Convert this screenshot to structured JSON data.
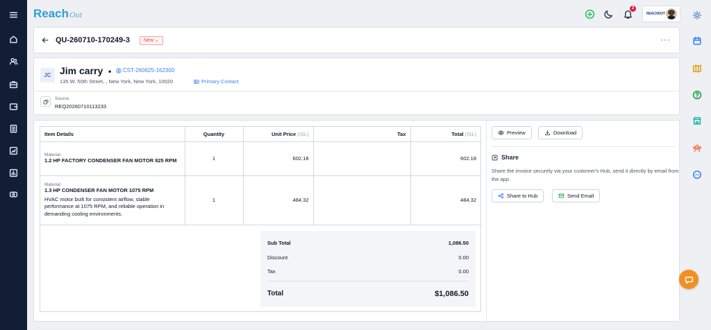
{
  "brand": {
    "name": "Reach",
    "suffix": "Out",
    "company_logo_text": "REACHOUT"
  },
  "notifications": {
    "count": "2"
  },
  "quote": {
    "number": "QU-260710-170249-3",
    "status": "New",
    "status_caret": "⌄",
    "more": "···"
  },
  "customer": {
    "initials": "JC",
    "name": "Jim carry",
    "separator": "•",
    "id": "CST-260625-162300",
    "address": "135 W. 50th Street, , New York, New York, 10020",
    "contact_label": "Primary Contact",
    "source_label": "Source",
    "source_value": "REQ20260710113233"
  },
  "table": {
    "headers": {
      "item": "Item Details",
      "qty": "Quantity",
      "price": "Unit Price",
      "price_note": "(ISL)",
      "tax": "Tax",
      "total": "Total",
      "total_note": "(ISL)"
    },
    "rows": [
      {
        "type": "Material",
        "name": "1.2 HP FACTORY CONDENSER FAN MOTOR 825 RPM",
        "description": "",
        "quantity": "1",
        "unit_price": "602.18",
        "tax": "",
        "total": "602.18"
      },
      {
        "type": "Material",
        "name": "1.3 HP CONDENSER FAN MOTOR 1075 RPM",
        "description": "HVAC motor built for consistent airflow, stable performance at 1075 RPM, and reliable operation in demanding cooling environments.",
        "quantity": "1",
        "unit_price": "484.32",
        "tax": "",
        "total": "484.32"
      }
    ]
  },
  "totals": {
    "subtotal_label": "Sub Total",
    "subtotal": "1,086.50",
    "discount_label": "Discount",
    "discount": "0.00",
    "tax_label": "Tax",
    "tax": "0.00",
    "total_label": "Total",
    "total": "$1,086.50"
  },
  "actions": {
    "preview": "Preview",
    "download": "Download"
  },
  "share": {
    "title": "Share",
    "description": "Share the invoice securely via your customer's Hub, send it directly by email from the app.",
    "hub_button": "Share to Hub",
    "email_button": "Send Email"
  },
  "colors": {
    "nav_bg": "#121e35",
    "brand": "#2f9fd8",
    "link": "#3b82f6",
    "chat": "#f39022",
    "status": "#dc4a4a"
  }
}
